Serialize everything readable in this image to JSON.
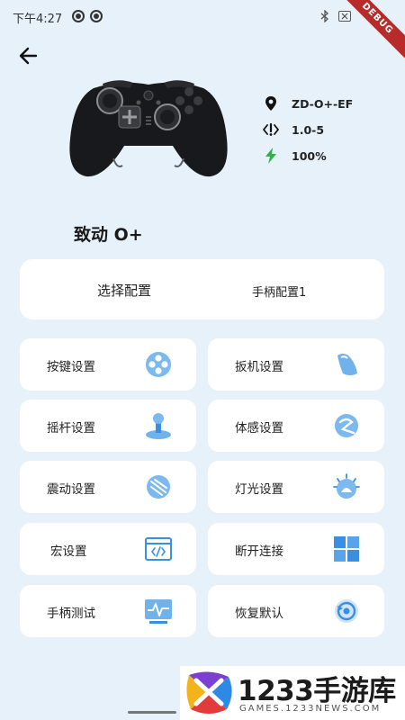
{
  "status_bar": {
    "time": "下午4:27",
    "debug_label": "DEBUG"
  },
  "device": {
    "name": "致动 O+",
    "model": "ZD-O+-EF",
    "firmware": "1.0-5",
    "battery": "100%"
  },
  "config": {
    "label": "选择配置",
    "value": "手柄配置1"
  },
  "menu": [
    {
      "label": "按键设置",
      "icon": "buttons-icon"
    },
    {
      "label": "扳机设置",
      "icon": "trigger-icon"
    },
    {
      "label": "摇杆设置",
      "icon": "joystick-icon"
    },
    {
      "label": "体感设置",
      "icon": "motion-icon"
    },
    {
      "label": "震动设置",
      "icon": "vibration-icon"
    },
    {
      "label": "灯光设置",
      "icon": "light-icon"
    },
    {
      "label": "宏设置",
      "icon": "macro-icon"
    },
    {
      "label": "断开连接",
      "icon": "disconnect-icon"
    },
    {
      "label": "手柄测试",
      "icon": "test-icon"
    },
    {
      "label": "恢复默认",
      "icon": "reset-icon"
    }
  ],
  "watermark": {
    "title": "1233手游库",
    "url": "GAMES.1233NEWS.COM"
  },
  "colors": {
    "background": "#e6f1fa",
    "card": "#ffffff",
    "accent": "#3b8fe0",
    "battery": "#2fb24a"
  }
}
